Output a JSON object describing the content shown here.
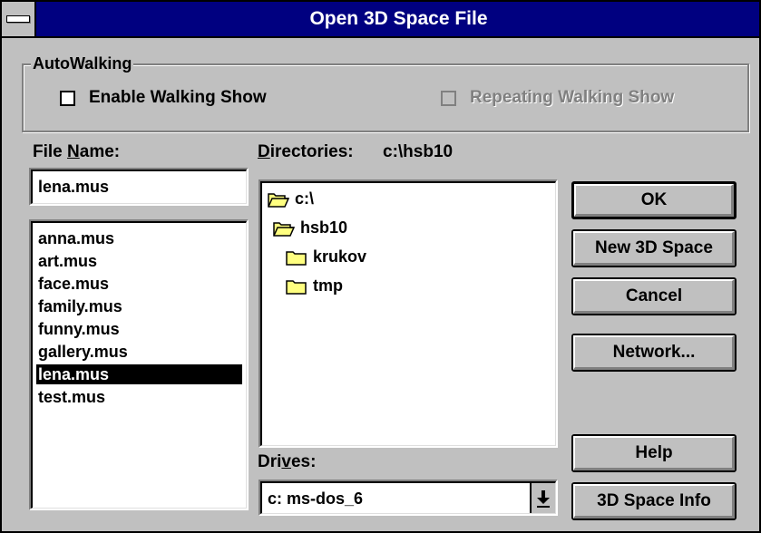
{
  "window": {
    "title": "Open 3D Space File"
  },
  "autowalking": {
    "group_label": "AutoWalking",
    "enable_label": "Enable Walking Show",
    "enable_checked": false,
    "repeat_label": "Repeating Walking Show",
    "repeat_checked": false,
    "repeat_enabled": false
  },
  "file_name": {
    "label_pre": "File ",
    "label_accel": "N",
    "label_post": "ame:",
    "value": "lena.mus",
    "files": [
      "anna.mus",
      "art.mus",
      "face.mus",
      "family.mus",
      "funny.mus",
      "gallery.mus",
      "lena.mus",
      "test.mus"
    ],
    "selected_index": 6
  },
  "directories": {
    "label_accel": "D",
    "label_post": "irectories:",
    "current_path": "c:\\hsb10",
    "tree": [
      {
        "name": "c:\\",
        "icon": "open-folder-icon"
      },
      {
        "name": "hsb10",
        "icon": "open-folder-icon"
      },
      {
        "name": "krukov",
        "icon": "closed-folder-icon"
      },
      {
        "name": "tmp",
        "icon": "closed-folder-icon"
      }
    ]
  },
  "drives": {
    "label_pre": "Dri",
    "label_accel": "v",
    "label_post": "es:",
    "selected": "c: ms-dos_6"
  },
  "buttons": {
    "ok": "OK",
    "new_space": "New 3D Space",
    "cancel": "Cancel",
    "network": "Network...",
    "help": "Help",
    "space_info": "3D Space Info"
  },
  "colors": {
    "titlebar": "#000080",
    "face": "#c0c0c0",
    "folder": "#ffff80"
  }
}
